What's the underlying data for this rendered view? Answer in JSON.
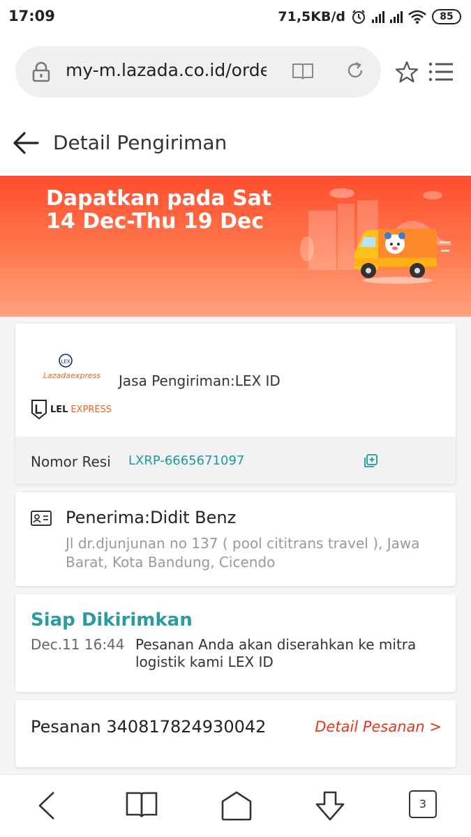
{
  "status_bar": {
    "time": "17:09",
    "network_speed": "71,5KB/d",
    "battery": "85"
  },
  "browser": {
    "url": "my-m.lazada.co.id/order"
  },
  "header": {
    "title": "Detail Pengiriman"
  },
  "banner": {
    "line1": "Dapatkan pada Sat",
    "line2": "14 Dec-Thu 19 Dec"
  },
  "courier": {
    "logo_lazada": "Lazadaexpress",
    "logo_lel_bold": "LEL",
    "logo_lel_rest": "EXPRESS",
    "service_label": "Jasa Pengiriman:LEX ID",
    "tracking_label": "Nomor Resi",
    "tracking_number": "LXRP-6665671097"
  },
  "recipient": {
    "name": "Penerima:Didit Benz",
    "address": "Jl dr.djunjunan no 137 ( pool cititrans travel ), Jawa Barat, Kota Bandung, Cicendo"
  },
  "tracking_status": {
    "title": "Siap Dikirimkan",
    "date": "Dec.11 16:44",
    "description": "Pesanan Anda akan diserahkan ke mitra logistik kami LEX ID"
  },
  "order": {
    "label": "Pesanan 340817824930042",
    "detail_link": "Detail Pesanan >"
  },
  "bottom_nav": {
    "tab_count": "3"
  },
  "colors": {
    "accent_orange": "#ff4d2e",
    "teal": "#2a9ca0",
    "link_red": "#e8361c"
  }
}
